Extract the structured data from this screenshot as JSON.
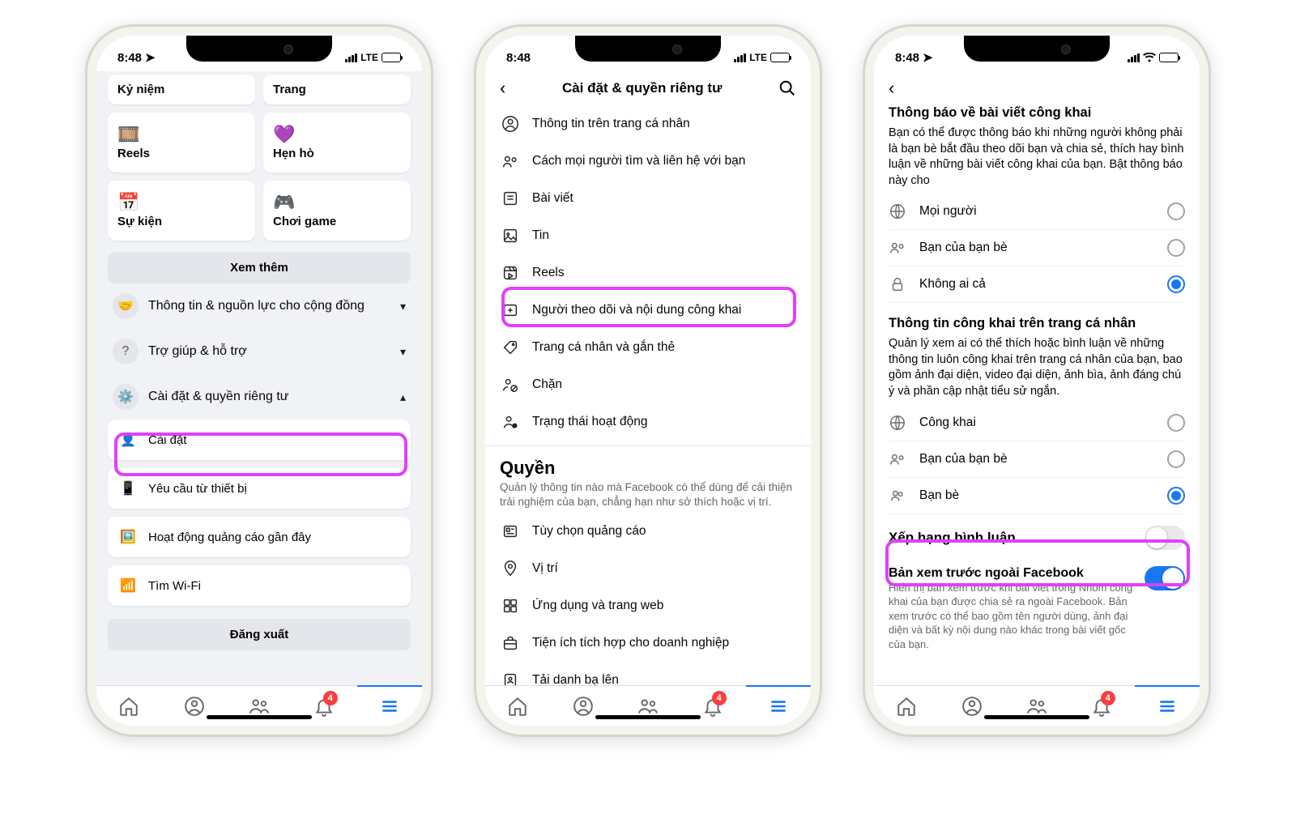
{
  "status": {
    "time": "8:48",
    "carrier": "LTE"
  },
  "badge_count": "4",
  "screen1": {
    "tiles": {
      "memories": "Kỷ niệm",
      "pages": "Trang",
      "reels": "Reels",
      "dating": "Hẹn hò",
      "events": "Sự kiện",
      "gaming": "Chơi game"
    },
    "see_more": "Xem thêm",
    "accordion": {
      "community": "Thông tin & nguồn lực cho cộng đồng",
      "help": "Trợ giúp & hỗ trợ",
      "settings_privacy": "Cài đặt & quyền riêng tư"
    },
    "sub": {
      "settings": "Cài đặt",
      "device_requests": "Yêu cầu từ thiết bị",
      "recent_ad": "Hoạt động quảng cáo gần đây",
      "find_wifi": "Tìm Wi-Fi"
    },
    "logout": "Đăng xuất"
  },
  "screen2": {
    "title": "Cài đặt & quyền riêng tư",
    "items": {
      "profile_info": "Thông tin trên trang cá nhân",
      "find_contact": "Cách mọi người tìm và liên hệ với bạn",
      "posts": "Bài viết",
      "stories": "Tin",
      "reels": "Reels",
      "followers": "Người theo dõi và nội dung công khai",
      "profile_tag": "Trang cá nhân và gắn thẻ",
      "blocking": "Chặn",
      "active_status": "Trạng thái hoạt động"
    },
    "section": {
      "title": "Quyền",
      "sub": "Quản lý thông tin nào mà Facebook có thể dùng để cải thiện trải nghiệm của bạn, chẳng hạn như sở thích hoặc vị trí."
    },
    "items2": {
      "ad_pref": "Tùy chọn quảng cáo",
      "location": "Vị trí",
      "apps_web": "Ứng dụng và trang web",
      "business_int": "Tiện ích tích hợp cho doanh nghiệp",
      "upload_contacts": "Tải danh bạ lên"
    }
  },
  "screen3": {
    "s1_title": "Thông báo về bài viết công khai",
    "s1_body": "Bạn có thể được thông báo khi những người không phải là bạn bè bắt đầu theo dõi bạn và chia sẻ, thích hay bình luận về những bài viết công khai của bạn. Bật thông báo này cho",
    "opts1": {
      "public": "Mọi người",
      "fof": "Bạn của bạn bè",
      "none": "Không ai cả"
    },
    "s2_title": "Thông tin công khai trên trang cá nhân",
    "s2_body": "Quản lý xem ai có thể thích hoặc bình luận về những thông tin luôn công khai trên trang cá nhân của bạn, bao gồm ảnh đại diện, video đại diện, ảnh bìa, ảnh đáng chú ý và phần cập nhật tiểu sử ngắn.",
    "opts2": {
      "public": "Công khai",
      "fof": "Bạn của bạn bè",
      "friends": "Bạn bè"
    },
    "rank_title": "Xếp hạng bình luận",
    "preview_title": "Bản xem trước ngoài Facebook",
    "preview_body": "Hiển thị bản xem trước khi bài viết trong Nhóm công khai của bạn được chia sẻ ra ngoài Facebook. Bản xem trước có thể bao gồm tên người dùng, ảnh đại diện và bất kỳ nội dung nào khác trong bài viết gốc của bạn."
  }
}
